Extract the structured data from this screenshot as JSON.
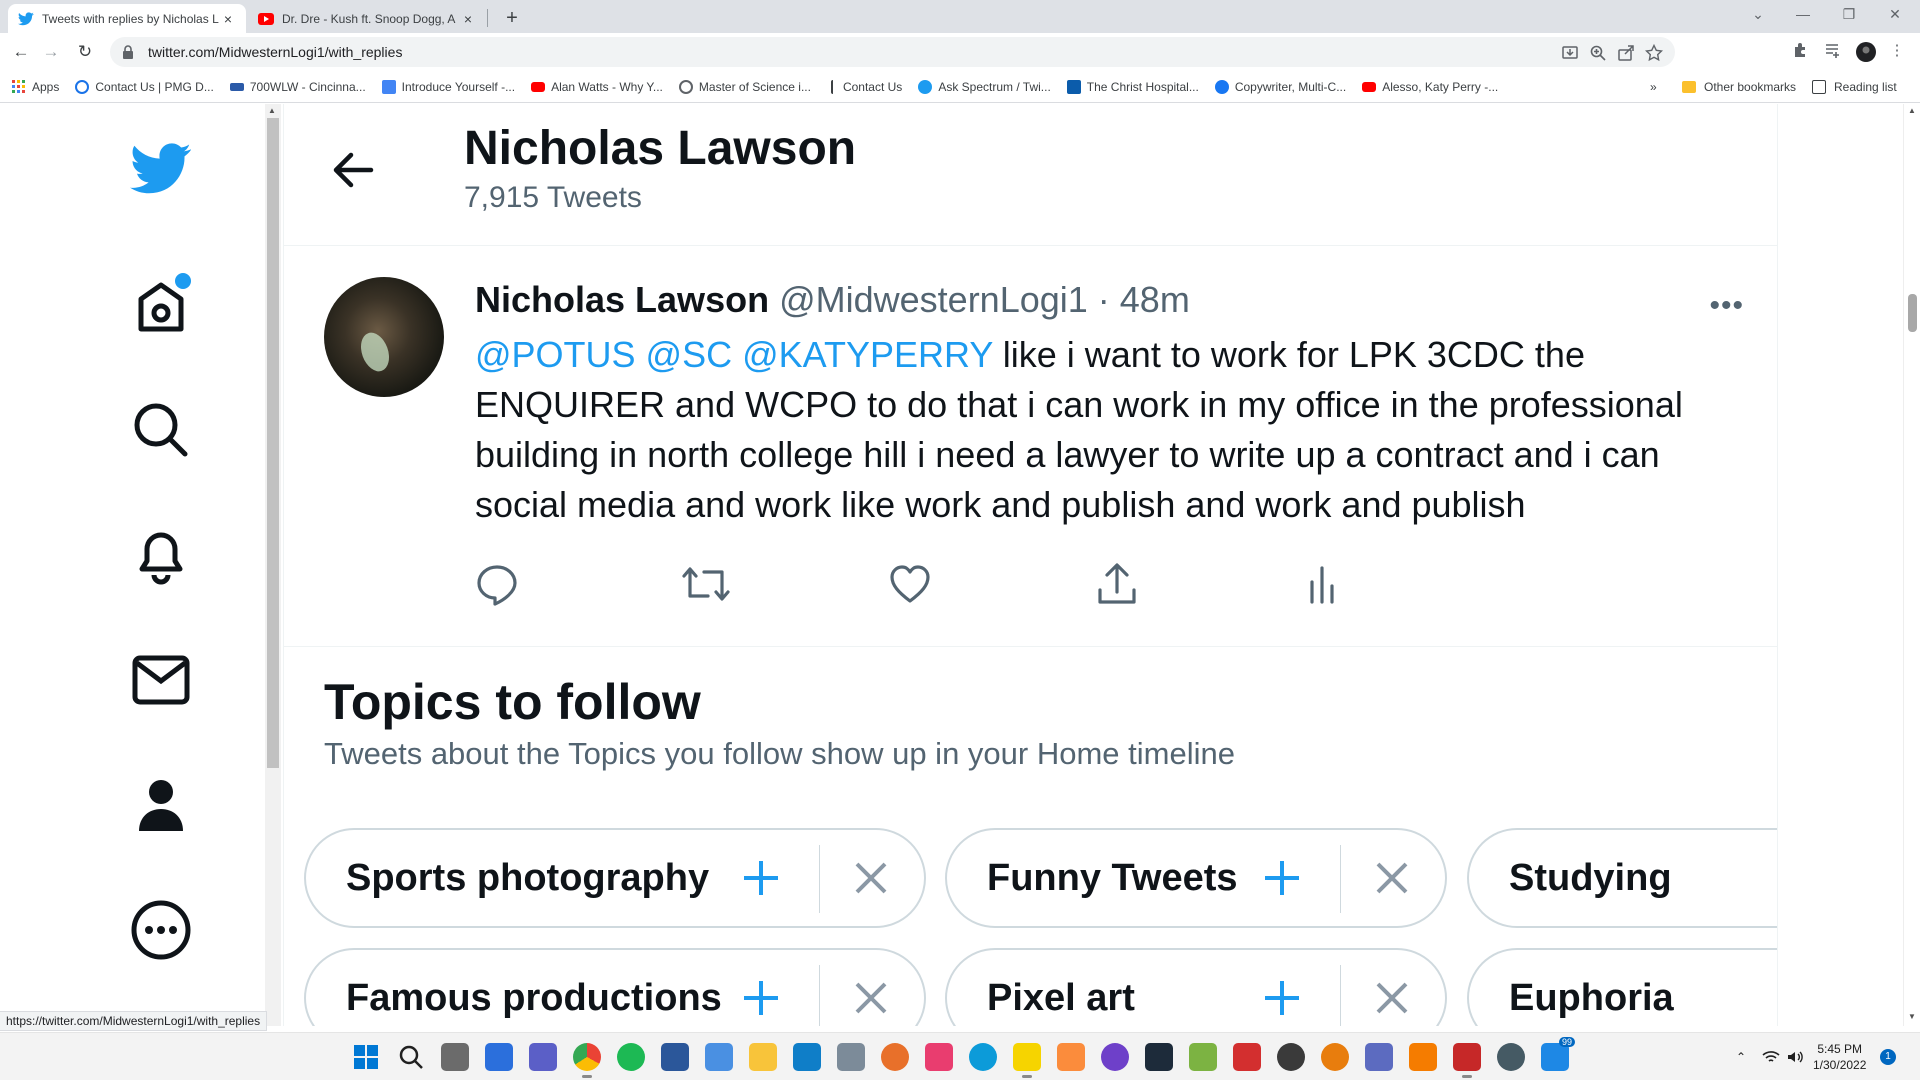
{
  "browser": {
    "tabs": [
      {
        "title": "Tweets with replies by Nicholas L",
        "close": "×",
        "favicon": "twitter-bird-icon"
      },
      {
        "title": "Dr. Dre - Kush ft. Snoop Dogg, A",
        "close": "×",
        "favicon": "youtube-icon"
      }
    ],
    "new_tab": "+",
    "url": "twitter.com/MidwesternLogi1/with_replies",
    "bookmarks": [
      {
        "label": "Apps",
        "icon": "apps-grid-icon",
        "color": "#e8453c"
      },
      {
        "label": "Contact Us | PMG D...",
        "icon": "pmg-icon",
        "color": "#1a73e8"
      },
      {
        "label": "700WLW - Cincinna...",
        "icon": "radio-icon",
        "color": "#2b5aa8"
      },
      {
        "label": "Introduce Yourself -...",
        "icon": "doc-icon",
        "color": "#4285f4"
      },
      {
        "label": "Alan Watts - Why Y...",
        "icon": "youtube-icon",
        "color": "#ff0000"
      },
      {
        "label": "Master of Science i...",
        "icon": "globe-icon",
        "color": "#5f6368"
      },
      {
        "label": "Contact Us",
        "icon": "tower-icon",
        "color": "#3c4043"
      },
      {
        "label": "Ask Spectrum / Twi...",
        "icon": "twitter-bird-icon",
        "color": "#1d9bf0"
      },
      {
        "label": "The Christ Hospital...",
        "icon": "hospital-icon",
        "color": "#0b5cab"
      },
      {
        "label": "Copywriter, Multi-C...",
        "icon": "facebook-icon",
        "color": "#1877f2"
      },
      {
        "label": "Alesso, Katy Perry -...",
        "icon": "youtube-icon",
        "color": "#ff0000"
      }
    ],
    "overflow": "»",
    "other_bookmarks": "Other bookmarks",
    "reading_list": "Reading list",
    "status_url": "https://twitter.com/MidwesternLogi1/with_replies"
  },
  "profile": {
    "name": "Nicholas Lawson",
    "tweet_count": "7,915 Tweets"
  },
  "tweet": {
    "author": "Nicholas Lawson",
    "handle_time": "@MidwesternLogi1 · 48m",
    "mentions": "@POTUS @SC @KATYPERRY",
    "text": " like i want to work for LPK 3CDC the ENQUIRER and WCPO to do that i can work in my office in the professional building in north college hill i need a lawyer to write up a contract and i can social media and work like work and publish and work and publish",
    "more": "•••"
  },
  "topics": {
    "title": "Topics to follow",
    "subtitle": "Tweets about the Topics you follow show up in your Home timeline",
    "chips": [
      {
        "label": "Sports photography"
      },
      {
        "label": "Funny Tweets"
      },
      {
        "label": "Studying"
      },
      {
        "label": "Famous productions"
      },
      {
        "label": "Pixel art"
      },
      {
        "label": "Euphoria"
      }
    ]
  },
  "taskbar": {
    "time": "5:45 PM",
    "date": "1/30/2022",
    "mail_badge": "99",
    "notification_count": "1"
  },
  "colors": {
    "twitter_blue": "#1d9bf0",
    "text_primary": "#0f1419",
    "text_secondary": "#536471",
    "border": "#cfd9de"
  }
}
